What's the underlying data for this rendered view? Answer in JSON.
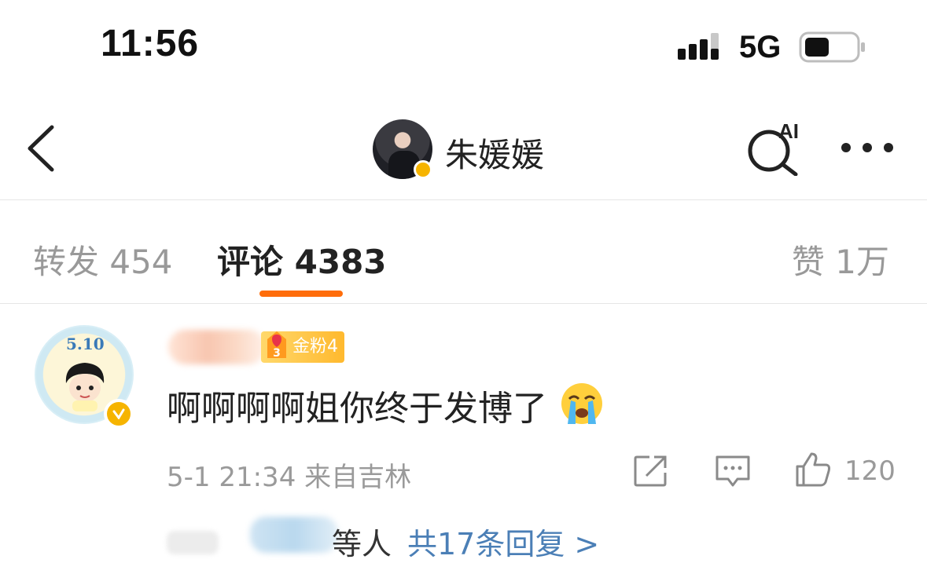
{
  "status_bar": {
    "time": "11:56",
    "network": "5G"
  },
  "header": {
    "name": "朱媛媛",
    "ai_label": "AI"
  },
  "tabs": {
    "reposts": "转发 454",
    "comments": "评论 4383",
    "likes": "赞 1万"
  },
  "comment": {
    "avatar_date": "5.10",
    "fan_badge": "金粉4",
    "text": "啊啊啊啊姐你终于发博了",
    "meta": "5-1 21:34 来自吉林",
    "like_count": "120"
  },
  "replies": {
    "suffix": "等人",
    "link": "共17条回复 >"
  },
  "colors": {
    "accent": "#ff6d0a",
    "link": "#4b7fb6",
    "verify": "#f6b400",
    "badge": "#ffb92e"
  },
  "icons": [
    "signal-icon",
    "battery-icon",
    "back-icon",
    "ai-search-icon",
    "more-icon",
    "verify-icon",
    "fan-badge-icon",
    "crying-emoji-icon",
    "share-icon",
    "reply-icon",
    "like-icon"
  ]
}
